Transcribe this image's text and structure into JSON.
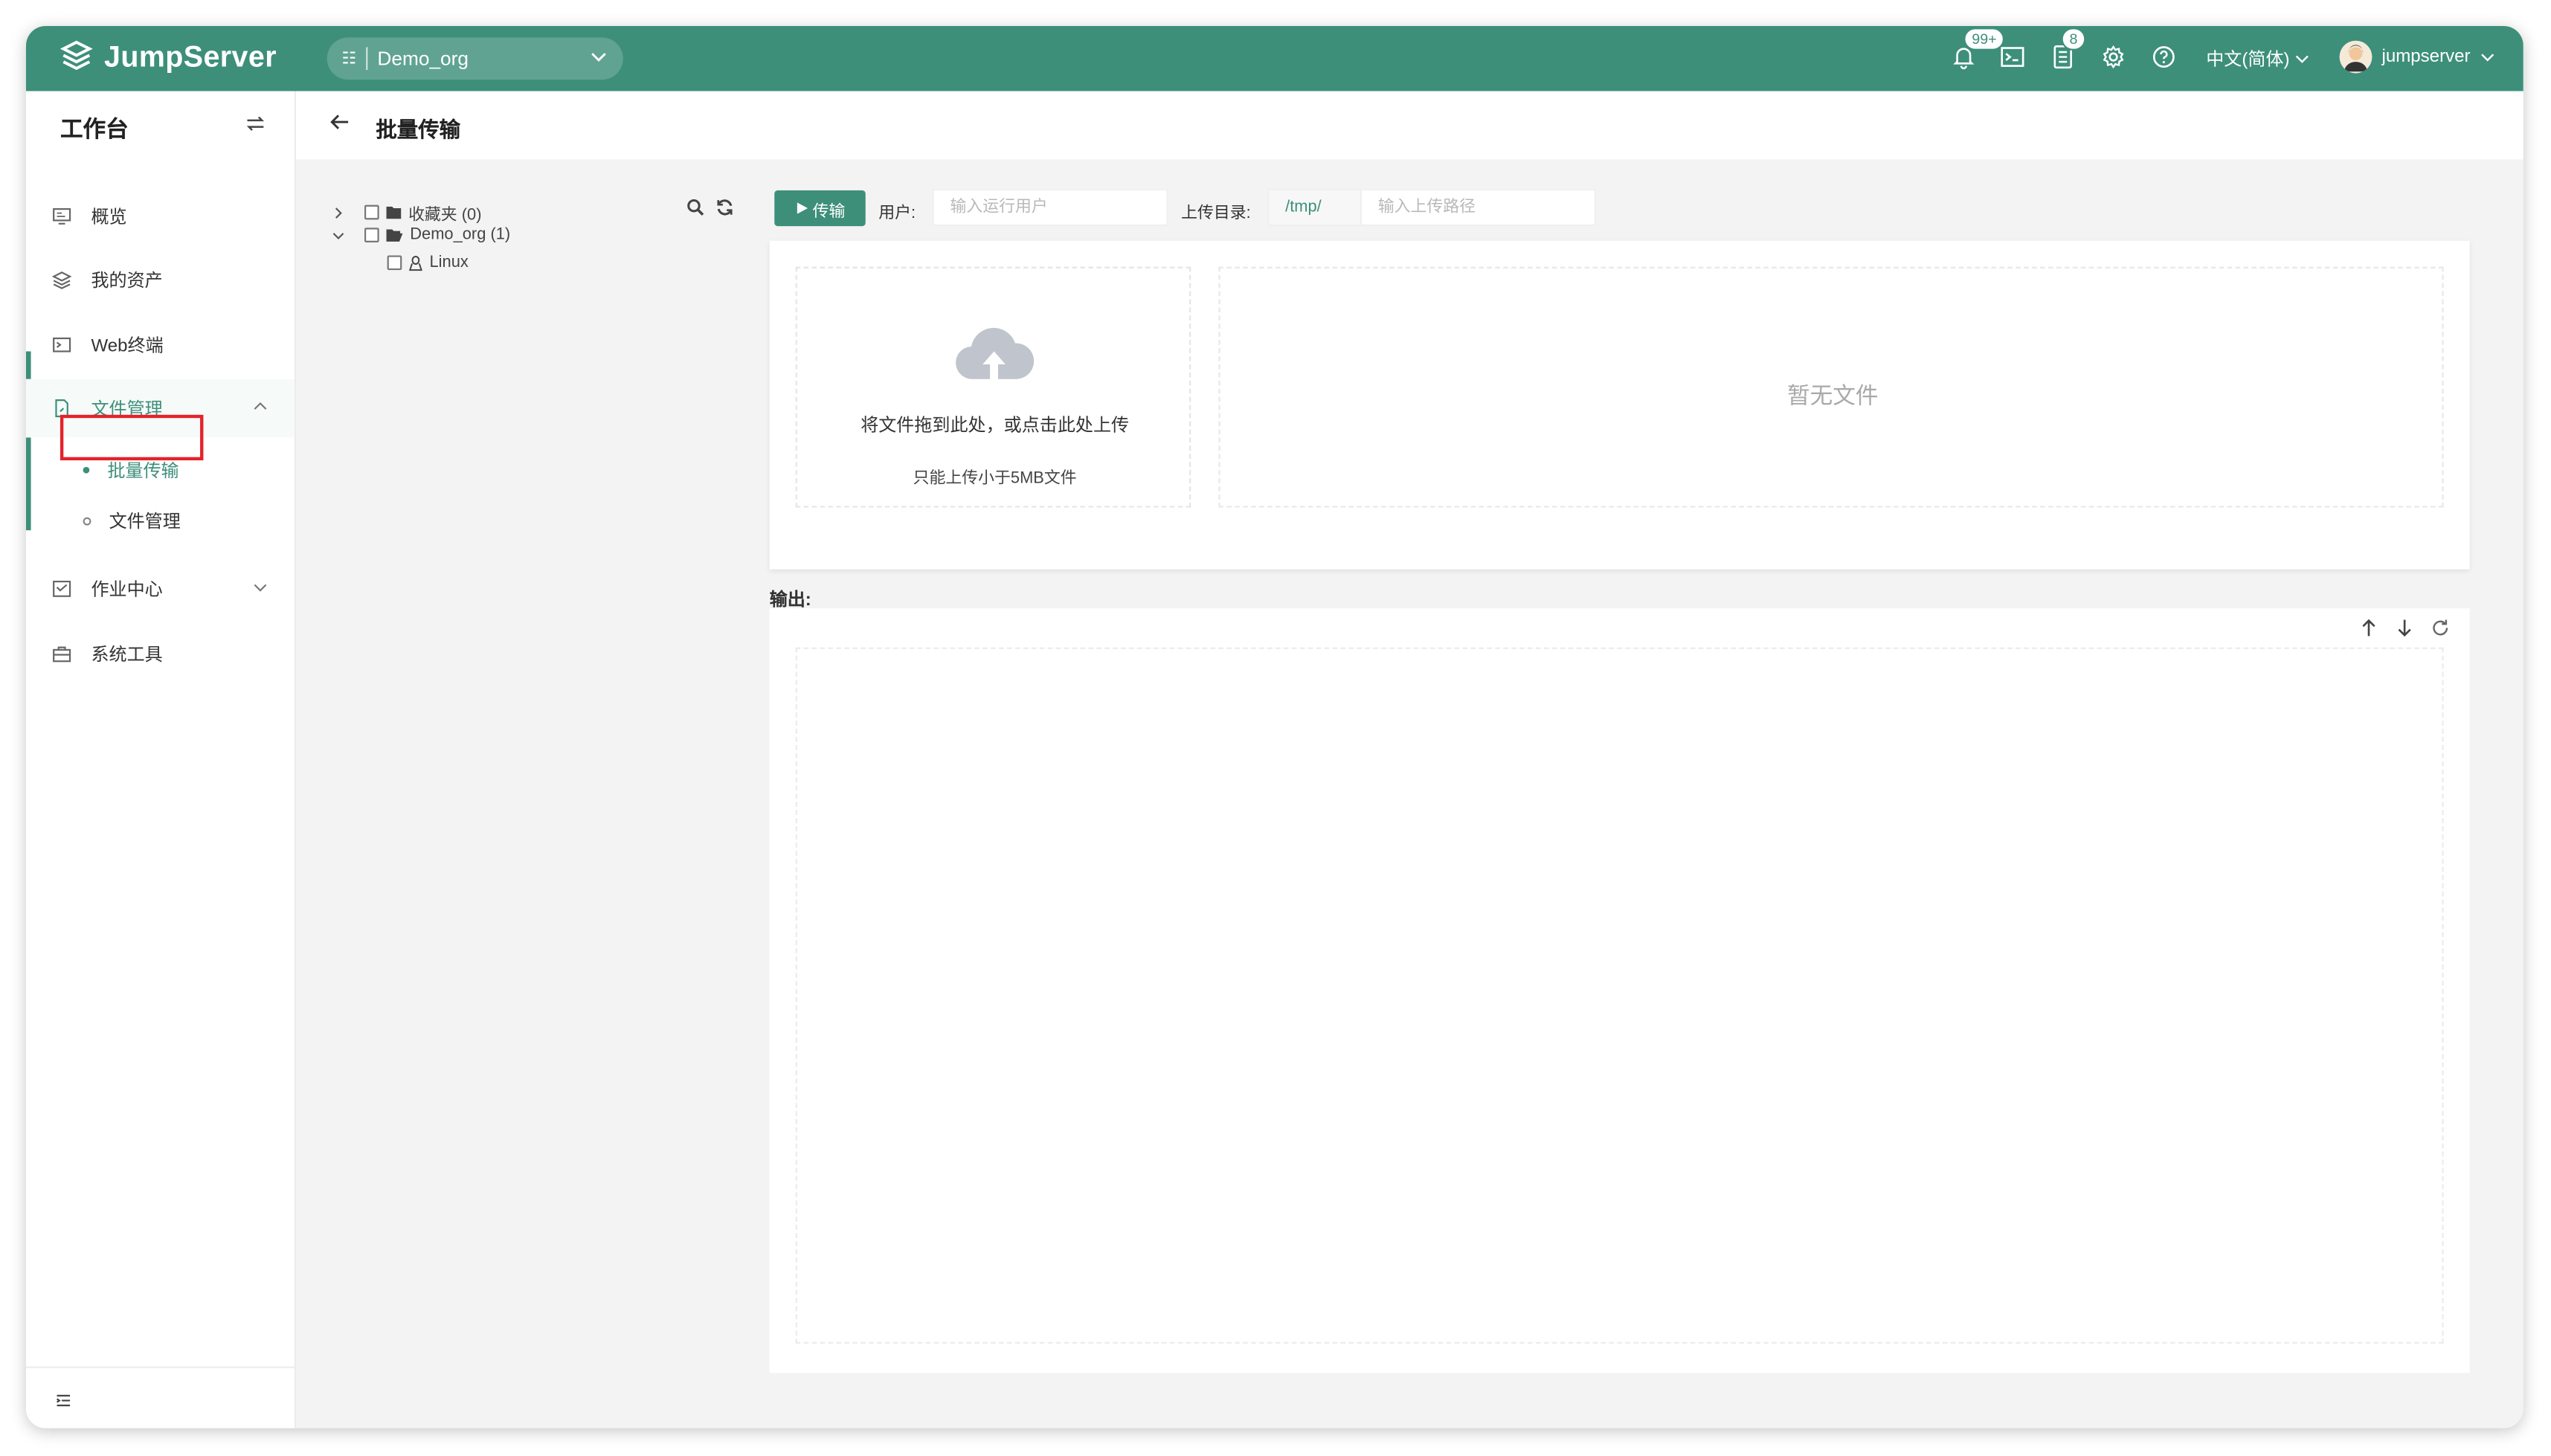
{
  "app": {
    "name": "JumpServer",
    "brand_color": "#3d8f7a"
  },
  "header": {
    "org": "Demo_org",
    "notification_badge": "99+",
    "tasks_badge": "8",
    "language": "中文(简体)",
    "username": "jumpserver"
  },
  "sidebar": {
    "title": "工作台",
    "items": [
      {
        "label": "概览",
        "icon": "monitor-icon"
      },
      {
        "label": "我的资产",
        "icon": "layers-icon"
      },
      {
        "label": "Web终端",
        "icon": "terminal-icon"
      },
      {
        "label": "文件管理",
        "icon": "file-icon",
        "expanded": true,
        "children": [
          {
            "label": "批量传输",
            "active": true
          },
          {
            "label": "文件管理"
          }
        ]
      },
      {
        "label": "作业中心",
        "icon": "job-icon"
      },
      {
        "label": "系统工具",
        "icon": "toolbox-icon"
      }
    ]
  },
  "page": {
    "title": "批量传输"
  },
  "tree": {
    "nodes": [
      {
        "label": "收藏夹 (0)"
      },
      {
        "label": "Demo_org (1)"
      },
      {
        "label": "Linux"
      }
    ]
  },
  "toolbar": {
    "run_label": "传输",
    "user_label": "用户:",
    "user_placeholder": "输入运行用户",
    "dir_label": "上传目录:",
    "dir_prefix": "/tmp/",
    "dir_placeholder": "输入上传路径"
  },
  "upload": {
    "drop_text": "将文件拖到此处，或点击此处上传",
    "limit_text": "只能上传小于5MB文件",
    "empty_text": "暂无文件"
  },
  "output": {
    "label": "输出:"
  }
}
